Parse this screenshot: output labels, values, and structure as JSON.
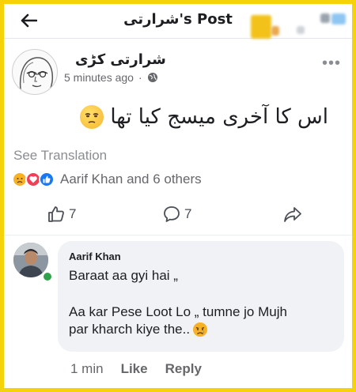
{
  "header": {
    "title": "شرارتی's Post"
  },
  "post": {
    "author": "شرارتی کڑی",
    "time": "5 minutes ago",
    "text": "اس کا آخری میسج کیا تھا",
    "see_translation": "See Translation",
    "reactions_label": "Aarif Khan and 6 others",
    "like_count": "7",
    "comment_count": "7"
  },
  "comment": {
    "author": "Aarif Khan",
    "line1": "Baraat aa gyi hai „",
    "line2": "Aa kar Pese Loot Lo „ tumne jo Mujh",
    "line3": "par kharch kiye the..",
    "time": "1 min",
    "like_label": "Like",
    "reply_label": "Reply"
  },
  "icons": {
    "back": "back-arrow-icon",
    "globe": "globe-icon",
    "more": "more-options-icon",
    "like": "thumbs-up-icon",
    "comment": "comment-icon",
    "share": "share-icon",
    "sad": "sad-reaction-icon",
    "love": "love-reaction-icon",
    "like_reaction": "like-reaction-icon",
    "unamused": "unamused-emoji-icon"
  },
  "colors": {
    "border": "#f5d20a",
    "secondary_text": "#65676b",
    "bubble": "#f0f2f5",
    "online": "#31a24c",
    "like_blue": "#1877f2",
    "love_red": "#f33e58"
  }
}
